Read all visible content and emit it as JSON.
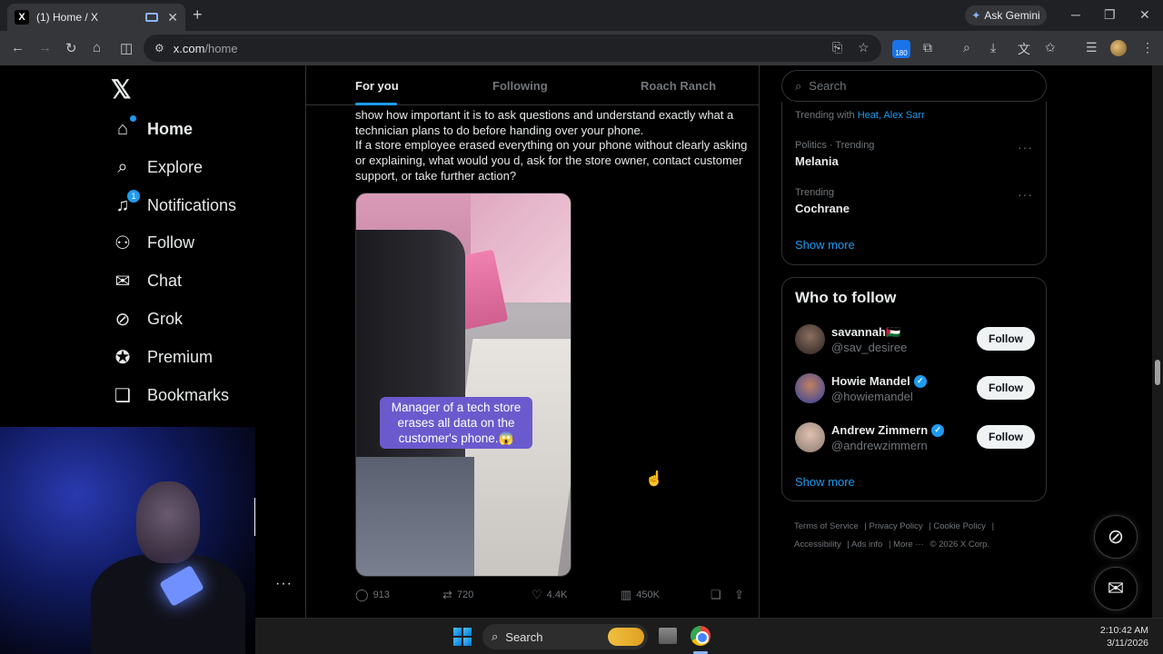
{
  "browser": {
    "tab_title": "(1) Home / X",
    "tab_close": "✕",
    "new_tab": "+",
    "ask_gemini": "Ask Gemini",
    "url_host": "x.com",
    "url_path": "/home",
    "extension_badge": "180",
    "window_controls": {
      "minimize": "─",
      "maximize": "❐",
      "close": "✕"
    }
  },
  "nav": {
    "logo": "𝕏",
    "items": [
      {
        "label": "Home",
        "icon": "home-icon"
      },
      {
        "label": "Explore",
        "icon": "search-icon"
      },
      {
        "label": "Notifications",
        "icon": "bell-icon",
        "badge": "1"
      },
      {
        "label": "Follow",
        "icon": "person-plus-icon"
      },
      {
        "label": "Chat",
        "icon": "mail-icon"
      },
      {
        "label": "Grok",
        "icon": "grok-icon"
      },
      {
        "label": "Premium",
        "icon": "verified-badge-icon"
      },
      {
        "label": "Bookmarks",
        "icon": "bookmark-icon"
      }
    ],
    "more_dots": "···"
  },
  "feed": {
    "tabs": [
      "For you",
      "Following",
      "Roach Ranch"
    ],
    "active_tab": "For you",
    "post_text_1": "show how important it is to ask questions and understand exactly what a technician plans to do before handing over your phone.",
    "post_text_2": "If a store employee erased everything on your phone without clearly asking or explaining, what would you d, ask for the store owner, contact customer support, or take further action?",
    "media_caption": "Manager of a tech store erases all data on the customer's phone.😱",
    "actions": {
      "replies": "913",
      "reposts": "720",
      "likes": "4.4K",
      "views": "450K"
    }
  },
  "sidebar": {
    "search_placeholder": "Search",
    "trending": {
      "top_context_prefix": "Trending with",
      "top_context_links": "Heat, Alex Sarr",
      "items": [
        {
          "context": "Politics · Trending",
          "title": "Melania"
        },
        {
          "context": "Trending",
          "title": "Cochrane"
        }
      ],
      "show_more": "Show more"
    },
    "who_to_follow": {
      "title": "Who to follow",
      "accounts": [
        {
          "name": "savannah🇵🇸",
          "handle": "@sav_desiree",
          "verified": false
        },
        {
          "name": "Howie Mandel",
          "handle": "@howiemandel",
          "verified": true
        },
        {
          "name": "Andrew Zimmern",
          "handle": "@andrewzimmern",
          "verified": true
        }
      ],
      "follow_label": "Follow",
      "show_more": "Show more"
    },
    "footer": [
      "Terms of Service",
      "Privacy Policy",
      "Cookie Policy",
      "Accessibility",
      "Ads info",
      "More ···",
      "© 2026 X Corp."
    ]
  },
  "taskbar": {
    "search_label": "Search",
    "time": "2:10:42 AM",
    "date": "3/11/2026"
  },
  "colors": {
    "accent": "#1d9bf0",
    "background": "#000000",
    "muted_text": "#71767b"
  }
}
